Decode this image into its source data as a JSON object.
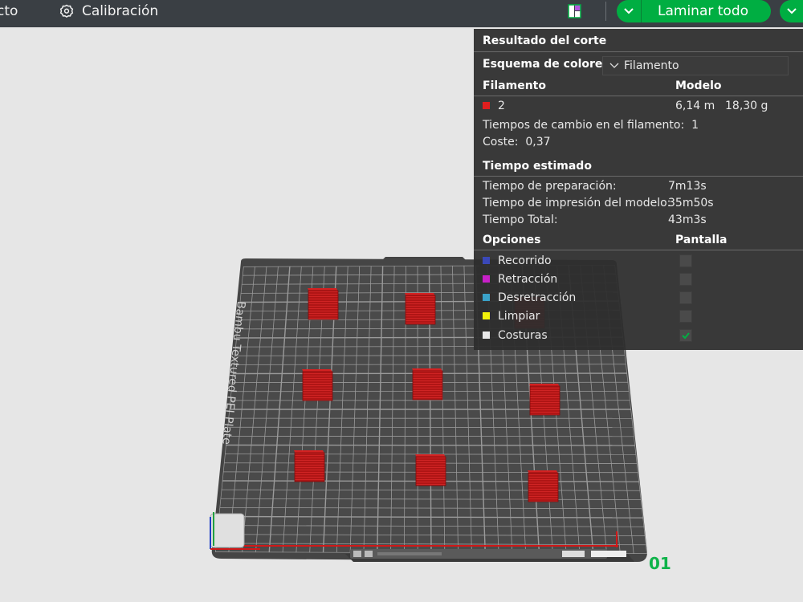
{
  "topbar": {
    "project_tab": "cto",
    "calibration_tab": "Calibración",
    "slice_label": "Laminar todo",
    "accent": "#00ae42"
  },
  "panel": {
    "title": "Resultado del corte",
    "scheme_label": "Esquema de colores",
    "scheme_value": "Filamento",
    "filament_header": "Filamento",
    "model_header": "Modelo",
    "filament": {
      "id": "2",
      "color": "#e01e1e",
      "length": "6,14 m",
      "weight": "18,30 g"
    },
    "change_times_label": "Tiempos de cambio en el filamento:",
    "change_times_value": "1",
    "cost_label": "Coste:",
    "cost_value": "0,37",
    "time_header": "Tiempo estimado",
    "times": [
      {
        "label": "Tiempo de preparación:",
        "value": "7m13s"
      },
      {
        "label": "Tiempo de impresión del modelo:",
        "value": "35m50s"
      },
      {
        "label": "Tiempo Total:",
        "value": "43m3s"
      }
    ],
    "options_header": "Opciones",
    "display_header": "Pantalla",
    "options": [
      {
        "label": "Recorrido",
        "color": "#3a48b8",
        "checked": false
      },
      {
        "label": "Retracción",
        "color": "#c820c8",
        "checked": false
      },
      {
        "label": "Desretracción",
        "color": "#3aa2c8",
        "checked": false
      },
      {
        "label": "Limpiar",
        "color": "#f2f20a",
        "checked": false
      },
      {
        "label": "Costuras",
        "color": "#e8e8e8",
        "checked": true
      }
    ]
  },
  "plate": {
    "label": "Bambu Textured PEI Plate",
    "number": "01"
  },
  "icons": {
    "calibration": "gear-icon",
    "layout": "layout-toggle-icon",
    "slice_dropdown": "chevron-down-icon"
  }
}
